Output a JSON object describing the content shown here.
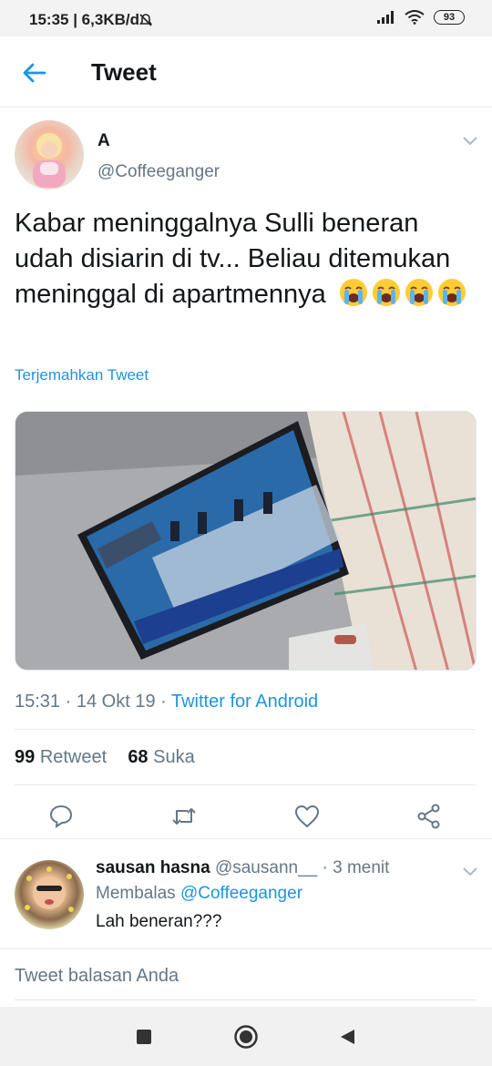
{
  "status_bar": {
    "time_net": "15:35 | 6,3KB/d",
    "battery": "93"
  },
  "header": {
    "title": "Tweet"
  },
  "tweet": {
    "author_name": "A",
    "author_handle": "@Coffeeganger",
    "text": "Kabar meninggalnya Sulli beneran udah disiarin di tv... Beliau ditemukan meninggal di apartmennya",
    "emoji": "loudly-crying-face x4",
    "translate_label": "Terjemahkan Tweet",
    "time": "15:31",
    "date": "14 Okt 19",
    "via": "Twitter for Android",
    "retweet_count": "99",
    "retweet_label": "Retweet",
    "like_count": "68",
    "like_label": "Suka"
  },
  "reply": {
    "name": "sausan hasna",
    "handle": "@sausann__",
    "age": "3 menit",
    "replying_prefix": "Membalas",
    "replying_to": "@Coffeeganger",
    "text": "Lah beneran???"
  },
  "composer": {
    "placeholder": "Tweet balasan Anda"
  },
  "colors": {
    "accent": "#1b95e0",
    "secondary_text": "#657786",
    "divider": "#e6ecf0"
  }
}
